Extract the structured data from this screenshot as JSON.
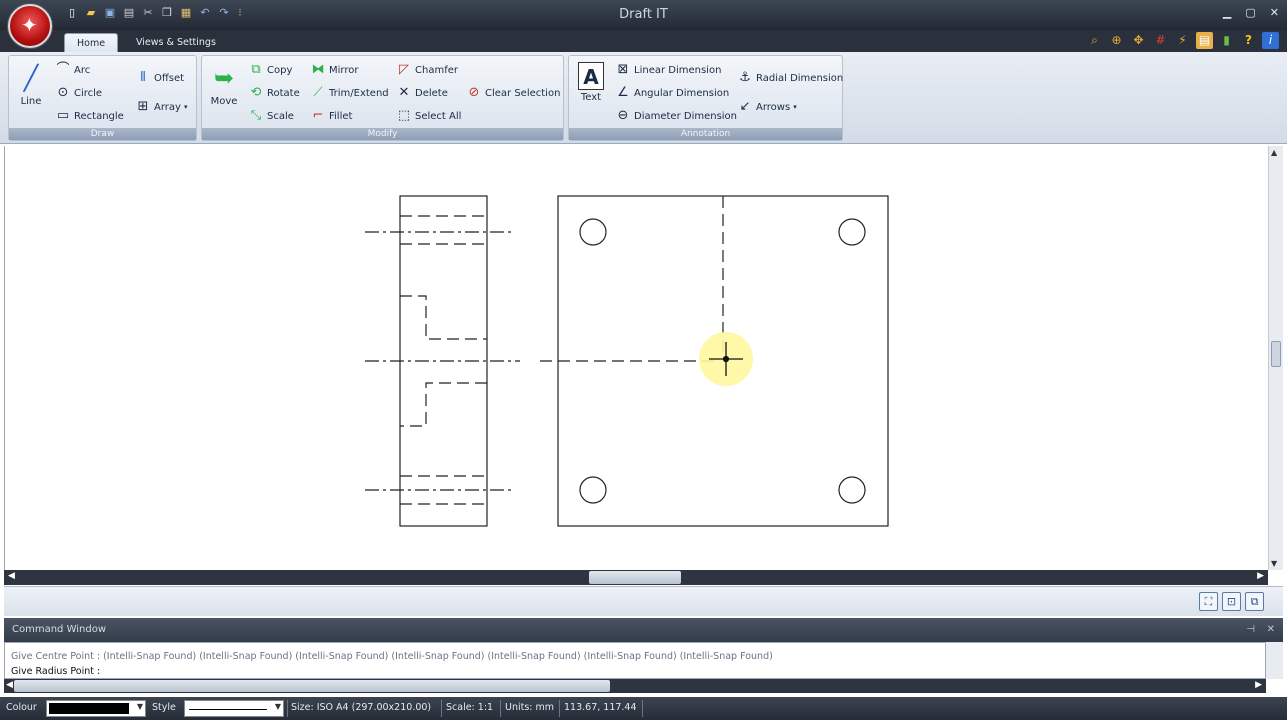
{
  "app": {
    "title": "Draft IT"
  },
  "tabs": [
    {
      "label": "Home",
      "active": true
    },
    {
      "label": "Views & Settings",
      "active": false
    }
  ],
  "ribbon": {
    "draw": {
      "caption": "Draw",
      "line": "Line",
      "arc": "Arc",
      "circle": "Circle",
      "rectangle": "Rectangle",
      "offset": "Offset",
      "array": "Array"
    },
    "modify": {
      "caption": "Modify",
      "move": "Move",
      "copy": "Copy",
      "rotate": "Rotate",
      "scale": "Scale",
      "mirror": "Mirror",
      "trim": "Trim/Extend",
      "fillet": "Fillet",
      "chamfer": "Chamfer",
      "delete": "Delete",
      "select_all": "Select All",
      "clear_selection": "Clear Selection"
    },
    "annotation": {
      "caption": "Annotation",
      "text": "Text",
      "linear": "Linear Dimension",
      "angular": "Angular Dimension",
      "diameter": "Diameter Dimension",
      "radial": "Radial Dimension",
      "arrows": "Arrows"
    }
  },
  "command_window": {
    "title": "Command Window",
    "line1": "Give Centre Point :  (Intelli-Snap Found) (Intelli-Snap Found) (Intelli-Snap Found) (Intelli-Snap Found) (Intelli-Snap Found) (Intelli-Snap Found) (Intelli-Snap Found)",
    "line2": "Give Radius Point :"
  },
  "status": {
    "colour_label": "Colour",
    "colour_value": "#000000",
    "style_label": "Style",
    "size": "Size: ISO A4 (297.00x210.00)",
    "scale": "Scale: 1:1",
    "units": "Units: mm",
    "coords": "113.67, 117.44"
  },
  "colors": {
    "titlebar": "#2b323d",
    "ribbon": "#dfe6ef",
    "group_caption": "#95a5ba",
    "cursor_highlight": "#fff7a0"
  }
}
